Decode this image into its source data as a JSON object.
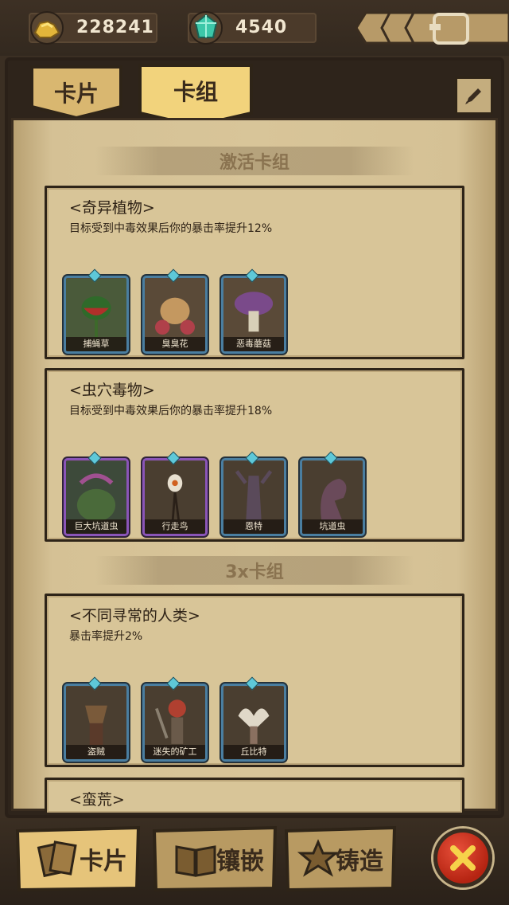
{
  "resources": {
    "gold": "228241",
    "gems": "4540"
  },
  "tabs": {
    "cards": "卡片",
    "decks": "卡组"
  },
  "sections": {
    "active": "激活卡组",
    "triple": "3x卡组"
  },
  "sets": [
    {
      "name": "<奇异植物>",
      "desc": "目标受到中毒效果后你的暴击率提升12%",
      "cards": [
        "捕蝇草",
        "臭臭花",
        "恶毒蘑菇"
      ]
    },
    {
      "name": "<虫穴毒物>",
      "desc": "目标受到中毒效果后你的暴击率提升18%",
      "cards": [
        "巨大坑道虫",
        "行走鸟",
        "恩特",
        "坑道虫"
      ]
    },
    {
      "name": "<不同寻常的人类>",
      "desc": "暴击率提升2%",
      "cards": [
        "盗贼",
        "迷失的矿工",
        "丘比特"
      ]
    },
    {
      "name": "<蛮荒>"
    }
  ],
  "bottom_tabs": {
    "cards": "卡片",
    "inlay": "镶嵌",
    "forge": "铸造"
  }
}
